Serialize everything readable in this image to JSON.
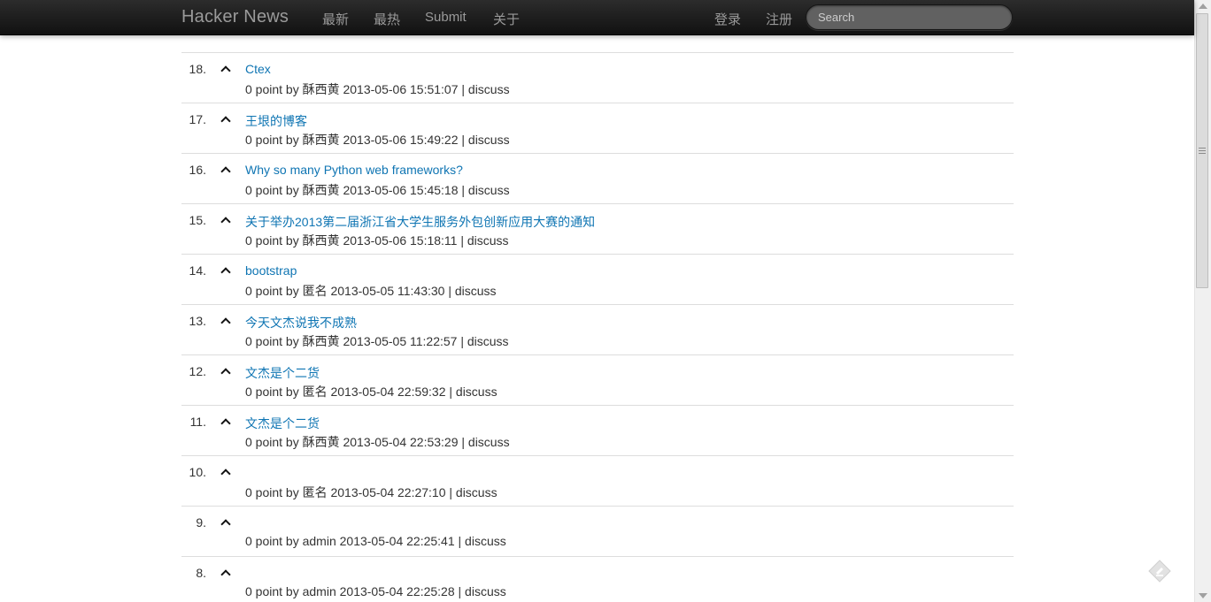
{
  "navbar": {
    "brand": "Hacker News",
    "links": [
      "最新",
      "最热",
      "Submit",
      "关于"
    ],
    "right_links": [
      "登录",
      "注册"
    ],
    "search_placeholder": "Search"
  },
  "items": [
    {
      "rank": "18.",
      "title": "Ctex",
      "meta_prefix": "0 point by 酥西黄 2013-05-06 15:51:07 | ",
      "discuss": "discuss"
    },
    {
      "rank": "17.",
      "title": "王垠的博客",
      "meta_prefix": "0 point by 酥西黄 2013-05-06 15:49:22 | ",
      "discuss": "discuss"
    },
    {
      "rank": "16.",
      "title": "Why so many Python web frameworks?",
      "meta_prefix": "0 point by 酥西黄 2013-05-06 15:45:18 | ",
      "discuss": "discuss"
    },
    {
      "rank": "15.",
      "title": "关于举办2013第二届浙江省大学生服务外包创新应用大赛的通知",
      "meta_prefix": "0 point by 酥西黄 2013-05-06 15:18:11 | ",
      "discuss": "discuss"
    },
    {
      "rank": "14.",
      "title": "bootstrap",
      "meta_prefix": "0 point by 匿名 2013-05-05 11:43:30 | ",
      "discuss": "discuss"
    },
    {
      "rank": "13.",
      "title": "今天文杰说我不成熟",
      "meta_prefix": "0 point by 酥西黄 2013-05-05 11:22:57 | ",
      "discuss": "discuss"
    },
    {
      "rank": "12.",
      "title": "文杰是个二货",
      "meta_prefix": "0 point by 匿名 2013-05-04 22:59:32 | ",
      "discuss": "discuss"
    },
    {
      "rank": "11.",
      "title": "文杰是个二货",
      "meta_prefix": "0 point by 酥西黄 2013-05-04 22:53:29 | ",
      "discuss": "discuss"
    },
    {
      "rank": "10.",
      "title": "",
      "meta_prefix": "0 point by 匿名 2013-05-04 22:27:10 | ",
      "discuss": "discuss"
    },
    {
      "rank": "9.",
      "title": "",
      "meta_prefix": "0 point by admin 2013-05-04 22:25:41 | ",
      "discuss": "discuss"
    },
    {
      "rank": "8.",
      "title": "",
      "meta_prefix": "0 point by admin 2013-05-04 22:25:28 | ",
      "discuss": "discuss"
    }
  ],
  "colors": {
    "link": "#0f75b3",
    "navbar_bg": "#1b1b1b",
    "nav_text": "#9a9a9a",
    "divider": "#dddddd"
  }
}
